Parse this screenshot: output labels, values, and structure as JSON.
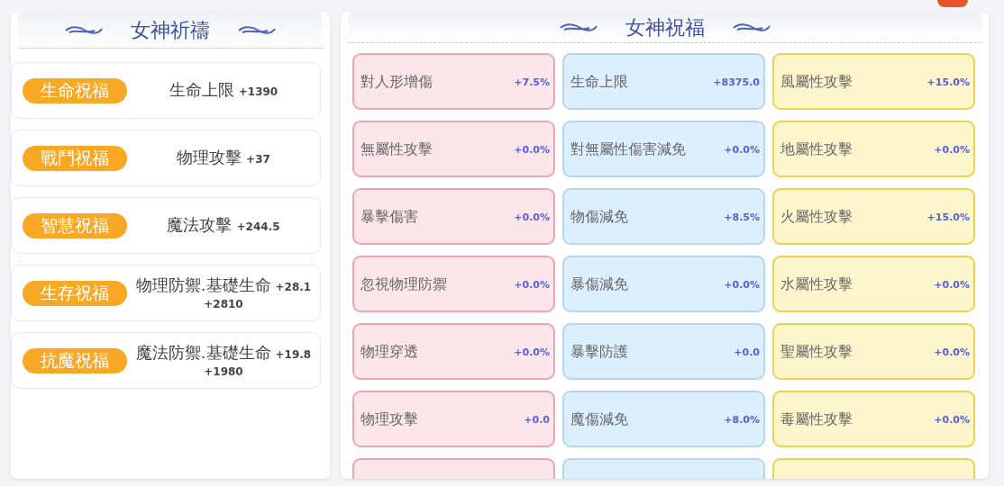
{
  "prayer_panel": {
    "title": "女神祈禱",
    "items": [
      {
        "badge": "生命祝福",
        "stat": "生命上限",
        "value": "+1390"
      },
      {
        "badge": "戰鬥祝福",
        "stat": "物理攻擊",
        "value": "+37"
      },
      {
        "badge": "智慧祝福",
        "stat": "魔法攻擊",
        "value": "+244.5"
      },
      {
        "badge": "生存祝福",
        "stat": "物理防禦.基礎生命",
        "value": "+28.1",
        "value_2": "+2810"
      },
      {
        "badge": "抗魔祝福",
        "stat": "魔法防禦.基礎生命",
        "value": "+19.8",
        "value_2": "+1980"
      }
    ]
  },
  "blessing_panel": {
    "title": "女神祝福",
    "columns": [
      {
        "kind": "pink",
        "items": [
          {
            "label": "對人形增傷",
            "value": "+7.5%"
          },
          {
            "label": "無屬性攻擊",
            "value": "+0.0%"
          },
          {
            "label": "暴擊傷害",
            "value": "+0.0%"
          },
          {
            "label": "忽視物理防禦",
            "value": "+0.0%"
          },
          {
            "label": "物理穿透",
            "value": "+0.0%"
          },
          {
            "label": "物理攻擊",
            "value": "+0.0"
          }
        ]
      },
      {
        "kind": "blue",
        "items": [
          {
            "label": "生命上限",
            "value": "+8375.0"
          },
          {
            "label": "對無屬性傷害減免",
            "value": "+0.0%"
          },
          {
            "label": "物傷減免",
            "value": "+8.5%"
          },
          {
            "label": "暴傷減免",
            "value": "+0.0%"
          },
          {
            "label": "暴擊防護",
            "value": "+0.0"
          },
          {
            "label": "魔傷減免",
            "value": "+8.0%"
          }
        ]
      },
      {
        "kind": "yellow",
        "items": [
          {
            "label": "風屬性攻擊",
            "value": "+15.0%"
          },
          {
            "label": "地屬性攻擊",
            "value": "+0.0%"
          },
          {
            "label": "火屬性攻擊",
            "value": "+15.0%"
          },
          {
            "label": "水屬性攻擊",
            "value": "+0.0%"
          },
          {
            "label": "聖屬性攻擊",
            "value": "+0.0%"
          },
          {
            "label": "毒屬性攻擊",
            "value": "+0.0%"
          }
        ]
      }
    ]
  }
}
